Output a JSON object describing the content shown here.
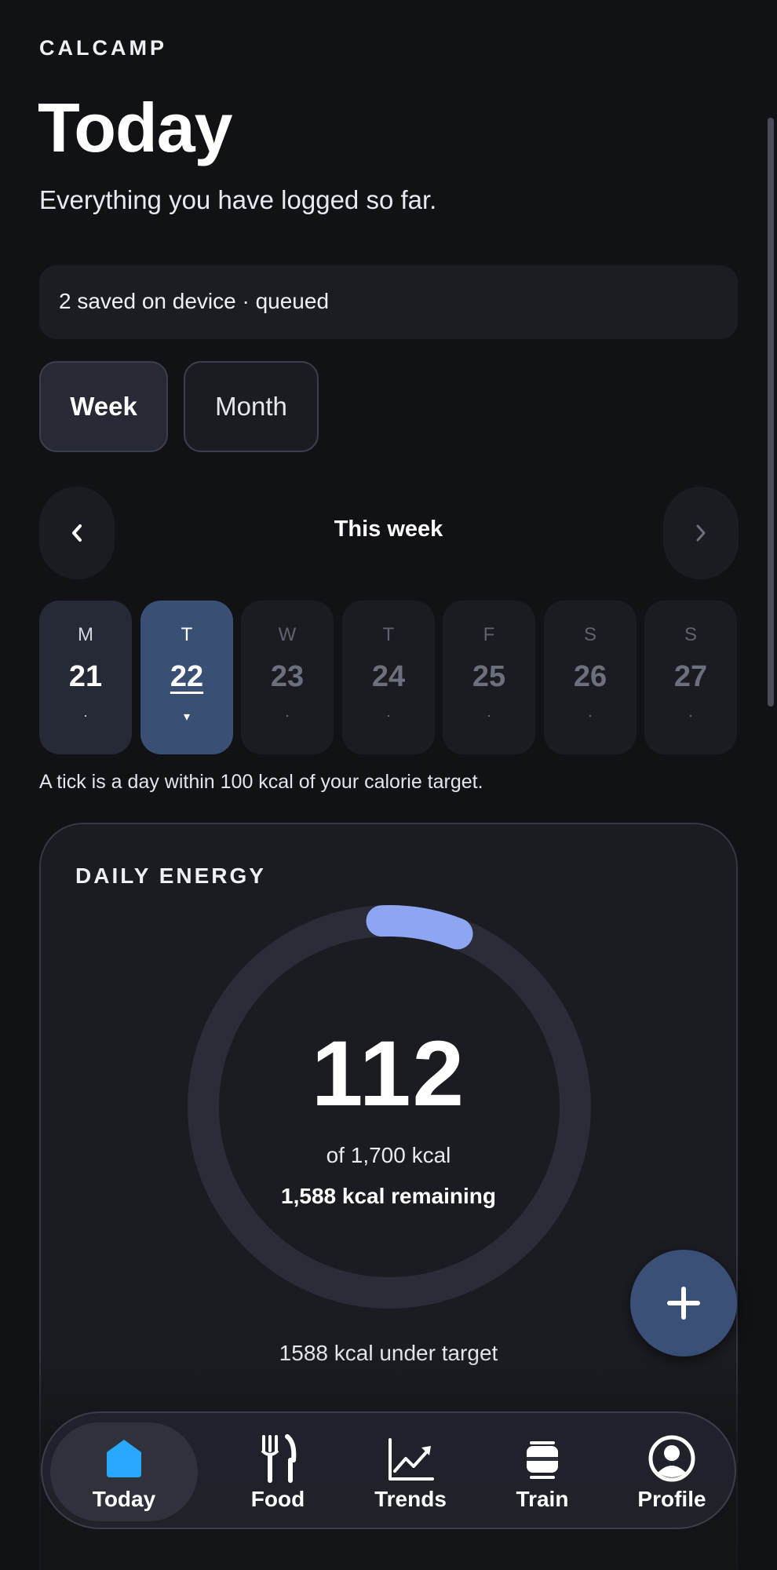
{
  "app": {
    "brand": "CALCAMP"
  },
  "header": {
    "title": "Today",
    "subtitle": "Everything you have logged so far."
  },
  "sync": {
    "status": "2 saved on device · queued"
  },
  "range_toggle": {
    "options": [
      {
        "label": "Week",
        "selected": true
      },
      {
        "label": "Month",
        "selected": false
      }
    ]
  },
  "week_nav": {
    "label": "This week",
    "prev_icon": "chevron-left-icon",
    "next_icon": "chevron-right-icon"
  },
  "days": [
    {
      "dow": "M",
      "num": "21",
      "mark": "·",
      "state": "past"
    },
    {
      "dow": "T",
      "num": "22",
      "mark": "▾",
      "state": "selected"
    },
    {
      "dow": "W",
      "num": "23",
      "mark": "·",
      "state": "future"
    },
    {
      "dow": "T",
      "num": "24",
      "mark": "·",
      "state": "future"
    },
    {
      "dow": "F",
      "num": "25",
      "mark": "·",
      "state": "future"
    },
    {
      "dow": "S",
      "num": "26",
      "mark": "·",
      "state": "future"
    },
    {
      "dow": "S",
      "num": "27",
      "mark": "·",
      "state": "future"
    }
  ],
  "tick_note": "A tick is a day within 100 kcal of your calorie target.",
  "energy": {
    "title": "DAILY ENERGY",
    "value": "112",
    "of_label": "of 1,700 kcal",
    "remaining_label": "1,588 kcal remaining",
    "under_label": "1588 kcal under target",
    "consumed": 112,
    "target": 1700,
    "ring_color": "#8ea6f2",
    "track_color": "#2a2c37"
  },
  "fab": {
    "icon": "plus-icon"
  },
  "tabs": [
    {
      "label": "Today",
      "icon": "home-icon",
      "active": true
    },
    {
      "label": "Food",
      "icon": "fork-knife-icon",
      "active": false
    },
    {
      "label": "Trends",
      "icon": "trend-chart-icon",
      "active": false
    },
    {
      "label": "Train",
      "icon": "train-icon",
      "active": false
    },
    {
      "label": "Profile",
      "icon": "profile-icon",
      "active": false
    }
  ],
  "colors": {
    "background": "#111216",
    "selected_day": "#3a4f74",
    "home_icon": "#2aa8ff"
  }
}
